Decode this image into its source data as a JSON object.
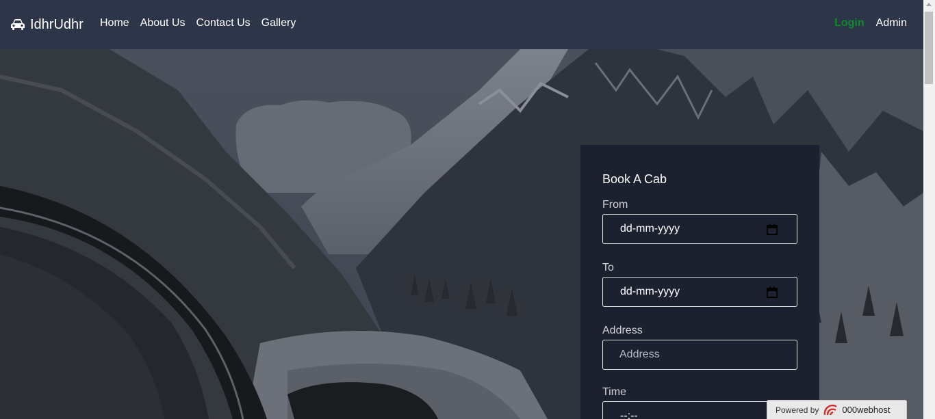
{
  "navbar": {
    "brand": "IdhrUdhr",
    "links": [
      "Home",
      "About Us",
      "Contact Us",
      "Gallery"
    ],
    "login": "Login",
    "admin": "Admin"
  },
  "booking": {
    "title": "Book A Cab",
    "from_label": "From",
    "from_value": "dd-mm-yyyy",
    "to_label": "To",
    "to_value": "dd-mm-yyyy",
    "address_label": "Address",
    "address_placeholder": "Address",
    "time_label": "Time",
    "time_value": "--:--"
  },
  "badge": {
    "prefix": "Powered by",
    "name": "000webhost"
  },
  "colors": {
    "navbar": "#2d3648",
    "card": "#1c2130",
    "login": "#0f8a2a"
  },
  "icons": [
    "car-icon",
    "calendar-icon",
    "webhost-logo"
  ]
}
